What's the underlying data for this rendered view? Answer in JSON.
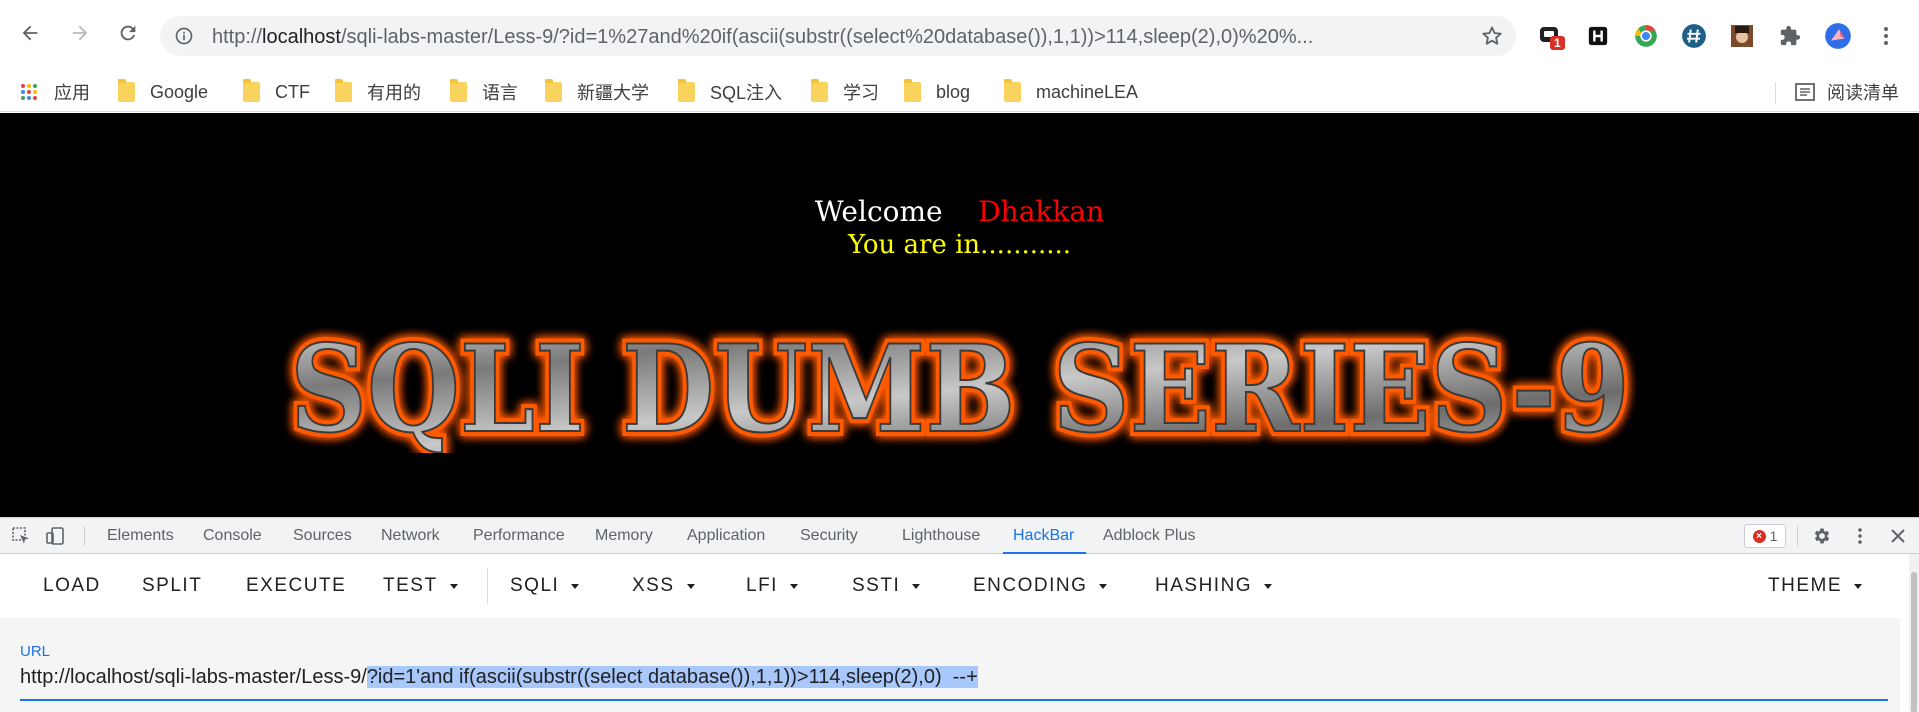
{
  "browser": {
    "url_prefix": "http://",
    "url_host": "localhost",
    "url_rest": "/sqli-labs-master/Less-9/?id=1%27and%20if(ascii(substr((select%20database()),1,1))>114,sleep(2),0)%20%...",
    "extension_badge": "1",
    "bookmarks": [
      "应用",
      "Google",
      "CTF",
      "有用的",
      "语言",
      "新疆大学",
      "SQL注入",
      "学习",
      "blog",
      "machineLEA"
    ],
    "reading_list": "阅读清单"
  },
  "page": {
    "welcome": "Welcome",
    "name": "Dhakkan",
    "status": "You are in...........",
    "banner": "SQLI DUMB SERIES-9"
  },
  "devtools": {
    "tabs": [
      "Elements",
      "Console",
      "Sources",
      "Network",
      "Performance",
      "Memory",
      "Application",
      "Security",
      "Lighthouse",
      "HackBar",
      "Adblock Plus"
    ],
    "active_tab": "HackBar",
    "error_count": "1"
  },
  "hackbar": {
    "buttons": [
      "LOAD",
      "SPLIT",
      "EXECUTE"
    ],
    "menus": [
      "TEST",
      "SQLI",
      "XSS",
      "LFI",
      "SSTI",
      "ENCODING",
      "HASHING"
    ],
    "theme": "THEME",
    "url_label": "URL",
    "url_base": "http://localhost/sqli-labs-master/Less-9/",
    "url_selected": "?id=1'and if(ascii(substr((select database()),1,1))>114,sleep(2),0)  --+"
  },
  "colors": {
    "accent": "#1a73e8",
    "page_bg": "#000000",
    "name_red": "#ff0000",
    "status_yellow": "#ffff00",
    "banner_glow": "#ff5a00"
  }
}
